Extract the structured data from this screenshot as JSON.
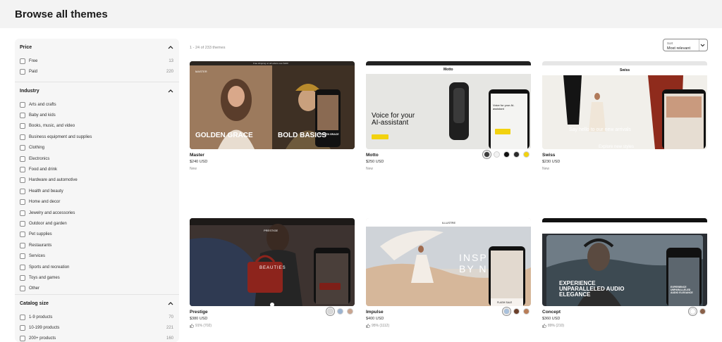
{
  "header": {
    "title": "Browse all themes"
  },
  "filters": {
    "price": {
      "title": "Price",
      "items": [
        {
          "label": "Free",
          "count": "13"
        },
        {
          "label": "Paid",
          "count": "220"
        }
      ]
    },
    "industry": {
      "title": "Industry",
      "items": [
        {
          "label": "Arts and crafts"
        },
        {
          "label": "Baby and kids"
        },
        {
          "label": "Books, music, and video"
        },
        {
          "label": "Business equipment and supplies"
        },
        {
          "label": "Clothing"
        },
        {
          "label": "Electronics"
        },
        {
          "label": "Food and drink"
        },
        {
          "label": "Hardware and automotive"
        },
        {
          "label": "Health and beauty"
        },
        {
          "label": "Home and decor"
        },
        {
          "label": "Jewelry and accessories"
        },
        {
          "label": "Outdoor and garden"
        },
        {
          "label": "Pet supplies"
        },
        {
          "label": "Restaurants"
        },
        {
          "label": "Services"
        },
        {
          "label": "Sports and recreation"
        },
        {
          "label": "Toys and games"
        },
        {
          "label": "Other"
        }
      ]
    },
    "catalog": {
      "title": "Catalog size",
      "items": [
        {
          "label": "1-9 products",
          "count": "70"
        },
        {
          "label": "10-199 products",
          "count": "221"
        },
        {
          "label": "200+ products",
          "count": "160"
        }
      ]
    }
  },
  "results": {
    "count_text": "1 - 24 of 233 themes"
  },
  "sort": {
    "label": "Sort",
    "value": "Most relevant"
  },
  "themes": [
    {
      "name": "Master",
      "price": "$240 USD",
      "meta": "New",
      "preview": {
        "left_text": "GOLDEN GRACE",
        "right_text": "BOLD BASICS",
        "phone_text": "GOLDEN GRACE",
        "banner": "Free shipping on all orders over $100",
        "brand": "MASTER"
      }
    },
    {
      "name": "Motto",
      "price": "$250 USD",
      "meta": "New",
      "preview": {
        "headline1": "Voice for your",
        "headline2": "AI-assistant",
        "phone_text": "Voice for your AI-assistant",
        "brand": "Motto"
      },
      "swatches": [
        "#3a3a3a",
        "#f2f2f2",
        "#111111",
        "#2b2b2b",
        "#f2d20f"
      ]
    },
    {
      "name": "Swiss",
      "price": "$230 USD",
      "meta": "New",
      "preview": {
        "headline": "Say hello to our new arrivals",
        "sub": "Explore new styles",
        "brand": "Swiss"
      }
    },
    {
      "name": "Prestige",
      "price": "$380 USD",
      "meta": "91% (702)",
      "preview": {
        "word": "BEAUTIES",
        "brand": "PRESTIGE"
      },
      "swatches": [
        "#d9d9d9",
        "#9bb3d0",
        "#c9a590"
      ]
    },
    {
      "name": "Impulse",
      "price": "$400 USD",
      "meta": "95% (1112)",
      "preview": {
        "big1": "INSP",
        "big2": "BY N",
        "brand": "ILLUSTRE",
        "tag": "FLASH SALE"
      },
      "swatches": [
        "#a9c1dc",
        "#6b3f2a",
        "#b97d57"
      ]
    },
    {
      "name": "Concept",
      "price": "$360 USD",
      "meta": "89% (210)",
      "preview": {
        "line1": "EXPERIENCE",
        "line2": "UNPARALLELED AUDIO",
        "line3": "ELEGANCE",
        "phone": "EXPERIENCE UNPARALLELED AUDIO ELEGANCE"
      },
      "swatches": [
        "#ffffff",
        "#8a6048"
      ]
    }
  ],
  "colors": {
    "topbar": "#f3f3f3",
    "sidebar": "#f6f6f6",
    "text": "#1a1a1a",
    "muted": "#8a8a8a"
  }
}
